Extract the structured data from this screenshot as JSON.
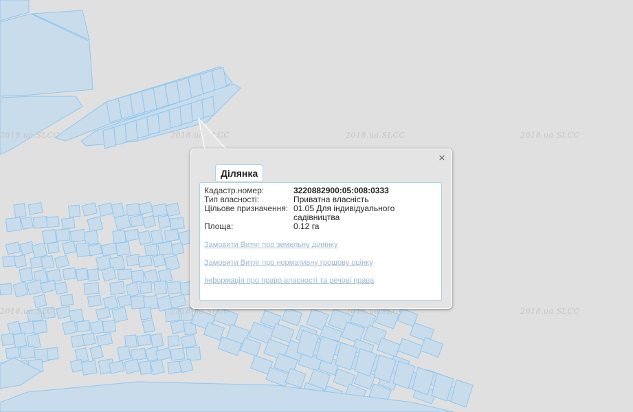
{
  "map": {
    "watermark": "2018.ua.SLCC",
    "parcel_fill": "#c8dcec",
    "parcel_stroke": "#8ec7f0",
    "background": "#e0e0e0"
  },
  "popup": {
    "tab_label": "Ділянка",
    "close_icon": "×",
    "fields": [
      {
        "key": "Кадастр.номер:",
        "value": "3220882900:05:008:0333"
      },
      {
        "key": "Тип власності:",
        "value": "Приватна власність"
      },
      {
        "key": "Цільове призначення:",
        "value": "01.05 Для індивідуального садівництва"
      },
      {
        "key": "Площа:",
        "value": "0.12 га"
      }
    ],
    "links": [
      "Замовити Витяг про земельну ділянку",
      "Замовити Витяг про нормативну грошову оцінку",
      "Інформація про право власності та речові права"
    ]
  }
}
